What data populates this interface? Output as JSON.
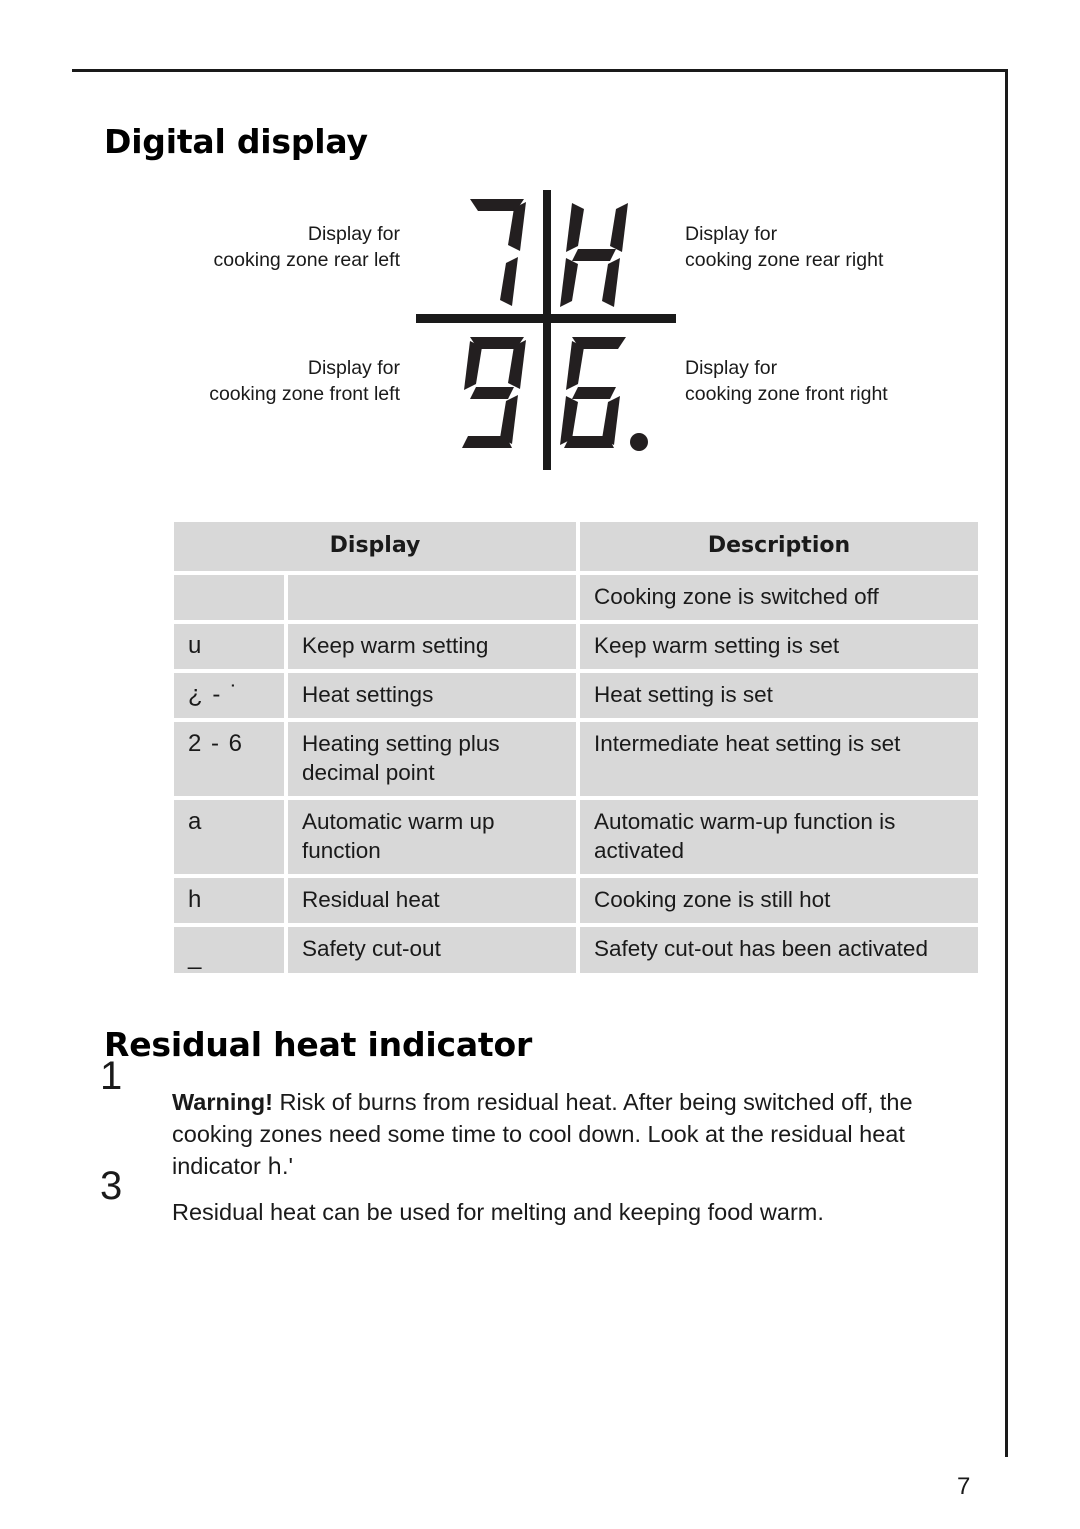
{
  "page": {
    "number": "7"
  },
  "sections": {
    "digital_display": {
      "heading": "Digital display"
    },
    "residual_heat": {
      "heading": "Residual heat indicator",
      "items": [
        {
          "marker": "1",
          "bold_lead": "Warning!",
          "text": " Risk of burns from residual heat. After being switched off, the cooking zones need some time to cool down. Look at the residual heat indicator ",
          "inline_symbol": "h",
          "text_after": ".'"
        },
        {
          "marker": "3",
          "text": "Residual heat can be used for melting and keeping food warm."
        }
      ]
    }
  },
  "diagram": {
    "labels": {
      "rear_left": {
        "line1": "Display for",
        "line2": "cooking zone rear left"
      },
      "rear_right": {
        "line1": "Display for",
        "line2": "cooking zone rear right"
      },
      "front_left": {
        "line1": "Display for",
        "line2": "cooking zone front left"
      },
      "front_right": {
        "line1": "Display for",
        "line2": "cooking zone front right"
      }
    },
    "digits": {
      "rear_left": "7",
      "rear_right": "H",
      "front_left": "9",
      "front_right": "6."
    }
  },
  "table": {
    "headers": {
      "display": "Display",
      "description": "Description"
    },
    "rows": [
      {
        "symbol": "",
        "name": "",
        "description": "Cooking zone is switched off"
      },
      {
        "symbol": "u",
        "name": "Keep warm setting",
        "description": "Keep warm setting is set"
      },
      {
        "symbol": "¿ - ˙",
        "name": "Heat settings",
        "description": "Heat setting is set"
      },
      {
        "symbol": "2 - 6",
        "name": "Heating setting plus decimal point",
        "description": "Intermediate heat setting is set"
      },
      {
        "symbol": "a",
        "name": "Automatic warm up function",
        "description": "Automatic warm-up function is activated"
      },
      {
        "symbol": "h",
        "name": "Residual heat",
        "description": "Cooking zone is still hot"
      },
      {
        "symbol": "_",
        "name": "Safety cut-out",
        "description": "Safety cut-out has been activated"
      }
    ]
  }
}
